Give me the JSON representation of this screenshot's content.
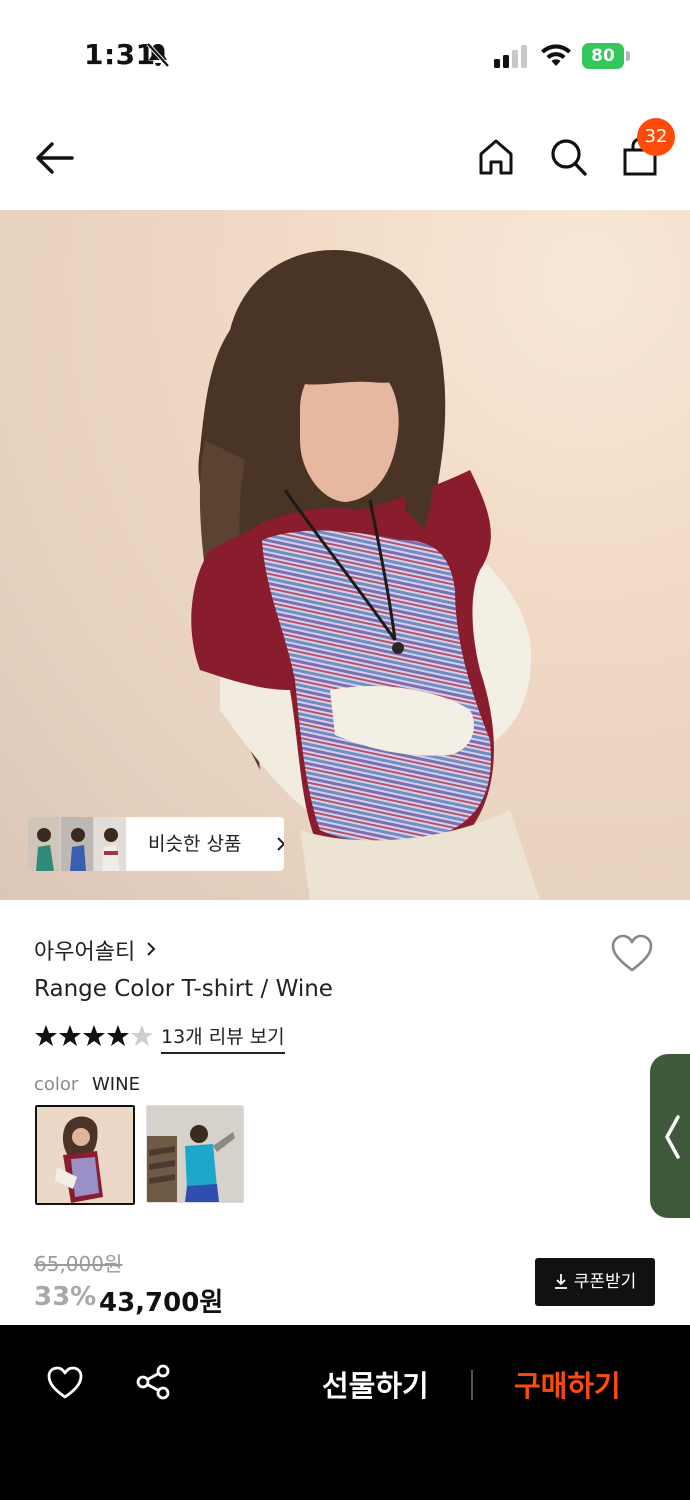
{
  "status_bar": {
    "time": "1:31",
    "battery": "80"
  },
  "nav": {
    "cart_count": "32"
  },
  "hero": {
    "similar_label": "비슷한 상품"
  },
  "product": {
    "brand": "아우어솔티",
    "title": "Range Color T-shirt / Wine",
    "rating_stars": 4.5,
    "review_link": "13개 리뷰 보기",
    "color_label": "color",
    "color_value": "WINE",
    "original_price": "65,000원",
    "discount": "33%",
    "sale_price": "43,700원",
    "coupon_label": "쿠폰받기"
  },
  "bottom_bar": {
    "gift_label": "선물하기",
    "buy_label": "구매하기"
  },
  "colors": {
    "accent": "#ff4b0a",
    "battery": "#34c759",
    "side_tab": "#3f5a3a"
  }
}
